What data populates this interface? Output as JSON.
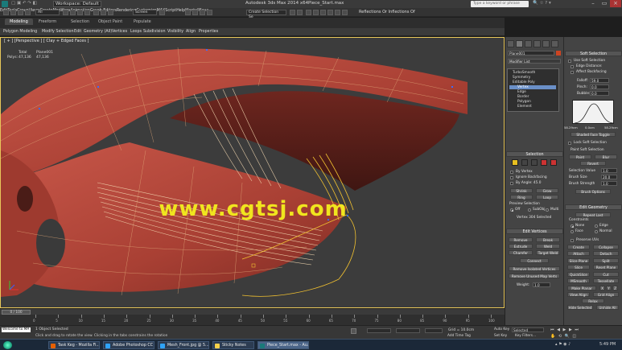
{
  "window": {
    "workspace_label": "Workspace: Default",
    "title": "Autodesk 3ds Max 2014 x64",
    "file_name": "Piece_Start.max",
    "search_placeholder": "Type a keyword or phrase"
  },
  "menu": [
    "Edit",
    "Tools",
    "Group",
    "Views",
    "Create",
    "Modifiers",
    "Animation",
    "Graph Editors",
    "Rendering",
    "Customize",
    "MAXScript",
    "Help",
    "MentalMaya"
  ],
  "toolbar": {
    "selection_filter": "All",
    "view_mode": "Screen",
    "selection_set": "Create Selection Se",
    "reflection_label": "Reflections Or Inflections Of"
  },
  "ribbon": {
    "tabs": [
      "Modeling",
      "Freeform",
      "Selection",
      "Object Paint",
      "Populate"
    ],
    "subitems": [
      "Polygon Modeling",
      "Modify Selection",
      "Edit",
      "Geometry (All)",
      "Vertices",
      "Loops",
      "Subdivision",
      "Visibility",
      "Align",
      "Properties"
    ]
  },
  "viewport": {
    "label": "[ + ] [Perspective ] [ Clay + Edged Faces ]",
    "stats_header": [
      "Total",
      "Plane001"
    ],
    "stats_row_label": "Polys:",
    "stats_values": [
      "47,136",
      "47,136"
    ],
    "watermark": "www.cgtsj.com"
  },
  "command_panel": {
    "object_name": "Plane001",
    "modifier_list": "Modifier List",
    "stack": [
      "TurboSmooth",
      "Symmetry",
      "Editable Poly",
      "Vertex",
      "Edge",
      "Border",
      "Polygon",
      "Element"
    ],
    "selection_title": "Selection",
    "selection_options": [
      "By Vertex",
      "Ignore Backfacing",
      "By Angle: 45.0"
    ],
    "shrink_label": "Shrink",
    "grow_label": "Grow",
    "ring_label": "Ring",
    "loop_label": "Loop",
    "preview_title": "Preview Selection",
    "preview_options": [
      "Off",
      "SubObj",
      "Multi"
    ],
    "vertices_selected": "Vertex 304 Selected",
    "edit_vertices_title": "Edit Vertices",
    "edit_buttons": [
      "Remove",
      "Break",
      "Extrude",
      "Weld",
      "Chamfer",
      "Target Weld",
      "Connect",
      "Remove Isolated Vertices",
      "Remove Unused Map Verts"
    ],
    "weight_label": "Weight:",
    "weight_value": "1.0"
  },
  "soft_panel": {
    "soft_title": "Soft Selection",
    "use_soft": "Use Soft Selection",
    "edge_distance": "Edge Distance:",
    "affect_backfacing": "Affect Backfacing",
    "falloff_label": "Falloff:",
    "falloff_value": "59.0",
    "pinch_label": "Pinch:",
    "pinch_value": "0.0",
    "bubble_label": "Bubble:",
    "bubble_value": "0.0",
    "curve_ticks": [
      "58.29cm",
      "0.0cm",
      "58.29cm"
    ],
    "shaded_face": "Shaded Face Toggle",
    "lock_soft": "Lock Soft Selection",
    "paint_soft_title": "Paint Soft Selection",
    "paint_buttons": [
      "Paint",
      "Blur",
      "Revert"
    ],
    "selection_value_label": "Selection Value",
    "selection_value": "1.0",
    "brush_size_label": "Brush Size",
    "brush_size": "20.0",
    "brush_strength_label": "Brush Strength",
    "brush_strength": "1.0",
    "brush_options": "Brush Options",
    "edit_geometry_title": "Edit Geometry",
    "repeat_last": "Repeat Last",
    "constraints_label": "Constraints",
    "constraint_options": [
      "None",
      "Edge",
      "Face",
      "Normal"
    ],
    "preserve_uvs": "Preserve UVs",
    "geo_buttons": [
      "Create",
      "Collapse",
      "Attach",
      "Detach",
      "Slice Plane",
      "Split",
      "Slice",
      "Reset Plane",
      "QuickSlice",
      "Cut",
      "MSmooth",
      "Tessellate",
      "Make Planar",
      "X",
      "Y",
      "Z",
      "View Align",
      "Grid Align",
      "Relax",
      "Hide Selected",
      "Unhide All"
    ]
  },
  "timeline": {
    "frame_display": "0 / 100",
    "ticks": [
      "0",
      "5",
      "10",
      "15",
      "20",
      "25",
      "30",
      "35",
      "40",
      "45",
      "50",
      "55",
      "60",
      "65",
      "70",
      "75",
      "80",
      "85",
      "90",
      "95",
      "100"
    ]
  },
  "status": {
    "welcome": "Welcome to MA",
    "selected": "1 Object Selected",
    "hint": "Click and drag to rotate the view. Clicking in the tabs constrains the rotation",
    "grid": "Grid = 10.0cm",
    "add_time_tag": "Add Time Tag",
    "auto_key": "Auto Key",
    "set_key": "Set Key",
    "key_mode": "Selected",
    "key_filters": "Key Filters..."
  },
  "taskbar": {
    "tasks": [
      "Task Keg - Mozilla Fi...",
      "Adobe Photoshop CC",
      "Mesh_Front.jpg @ 5...",
      "Sticky Notes",
      "Piece_Start.max - Au..."
    ],
    "clock": "5:49 PM"
  },
  "colors": {
    "mesh": "#b8483a",
    "mesh_dark": "#7a2a22",
    "wire": "#e8b27a",
    "selected_wire": "#f0c030",
    "watermark": "#f0e51e",
    "viewport_border": "#e8c75a",
    "stack_highlight": "#6a8fc7"
  }
}
